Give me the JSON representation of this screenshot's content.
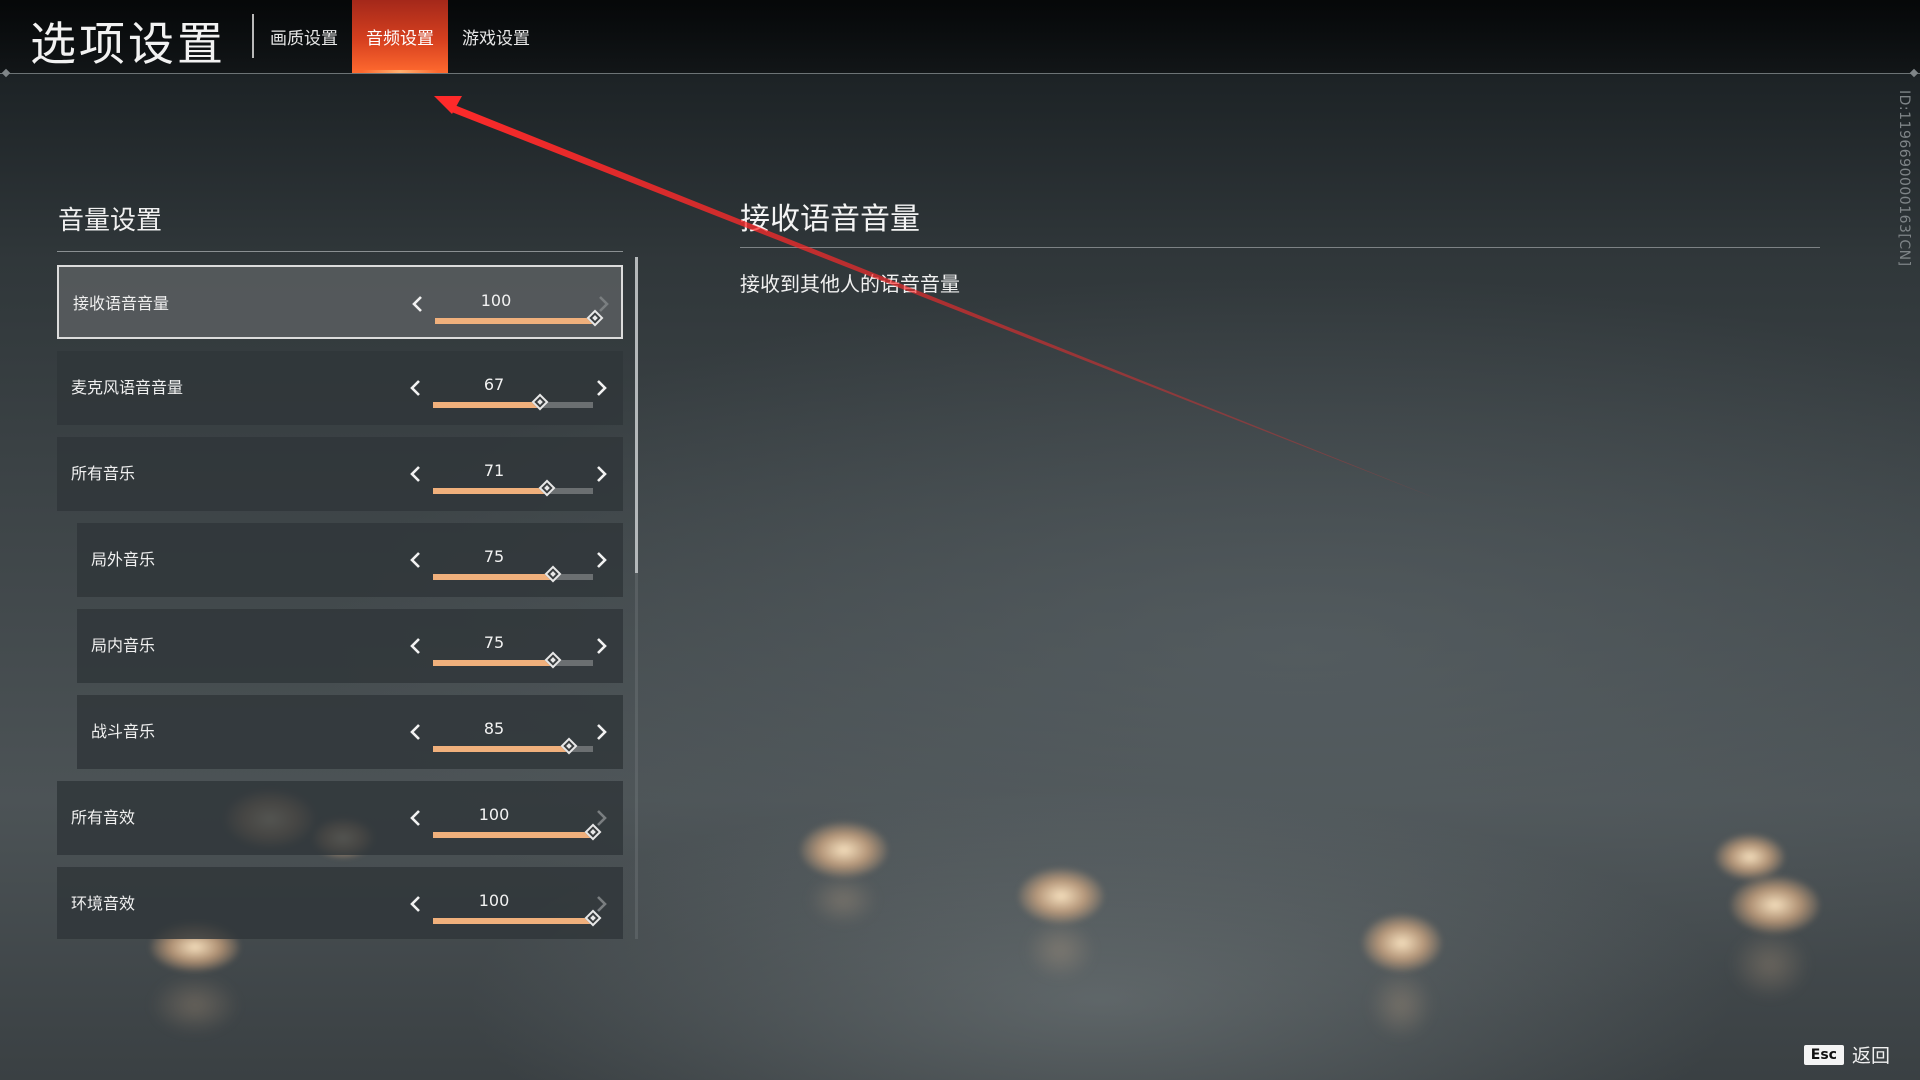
{
  "header": {
    "title": "选项设置",
    "tabs": [
      {
        "label": "画质设置",
        "active": false
      },
      {
        "label": "音频设置",
        "active": true
      },
      {
        "label": "游戏设置",
        "active": false
      }
    ]
  },
  "volume_section": {
    "title": "音量设置",
    "items": [
      {
        "label": "接收语音音量",
        "value": "100",
        "level": 1.0,
        "selected": true
      },
      {
        "label": "麦克风语音音量",
        "value": "67",
        "level": 0.67,
        "selected": false
      },
      {
        "label": "所有音乐",
        "value": "71",
        "level": 0.71,
        "selected": false
      },
      {
        "label": "局外音乐",
        "value": "75",
        "level": 0.75,
        "selected": false
      },
      {
        "label": "局内音乐",
        "value": "75",
        "level": 0.75,
        "selected": false
      },
      {
        "label": "战斗音乐",
        "value": "85",
        "level": 0.85,
        "selected": false
      },
      {
        "label": "所有音效",
        "value": "100",
        "level": 1.0,
        "selected": false
      },
      {
        "label": "环境音效",
        "value": "100",
        "level": 1.0,
        "selected": false
      }
    ]
  },
  "detail": {
    "title": "接收语音音量",
    "description": "接收到其他人的语音音量"
  },
  "build_id": "ID:1196690000163[CN]",
  "footer": {
    "esc_key": "Esc",
    "back_label": "返回"
  },
  "colors": {
    "active_tab": "#d6401f",
    "slider_fill": "#f0b07c",
    "annotation_arrow": "#ff2a2a"
  },
  "icons": [
    "chevron-left-icon",
    "chevron-right-icon",
    "diamond-thumb-icon"
  ]
}
